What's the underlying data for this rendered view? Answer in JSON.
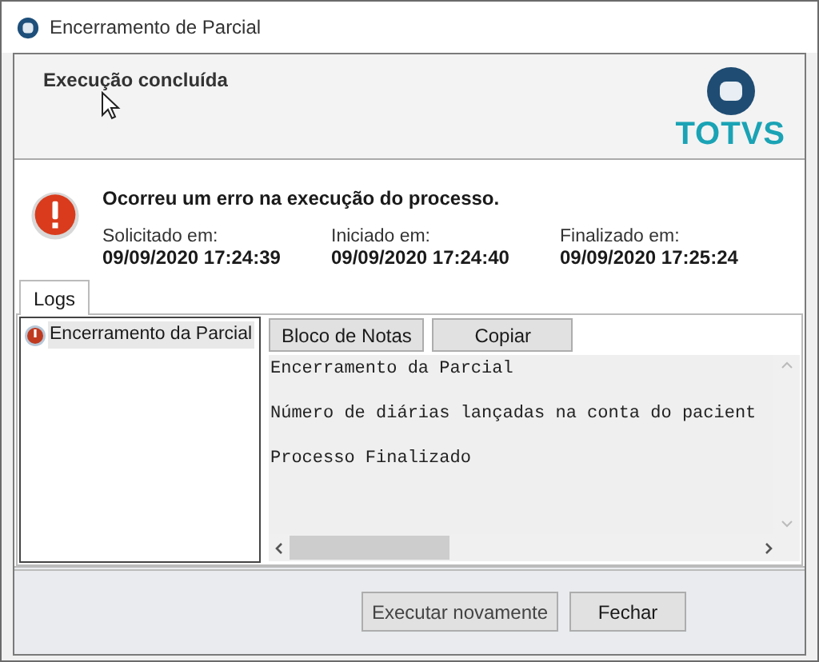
{
  "window": {
    "title": "Encerramento de Parcial"
  },
  "header": {
    "title": "Execução concluída",
    "logo": "TOTVS"
  },
  "message": "Ocorreu um erro na execução do processo.",
  "times": [
    {
      "label": "Solicitado em:",
      "value": "09/09/2020 17:24:39"
    },
    {
      "label": "Iniciado em:",
      "value": "09/09/2020 17:24:40"
    },
    {
      "label": "Finalizado em:",
      "value": "09/09/2020 17:25:24"
    }
  ],
  "tabs": [
    {
      "label": "Logs",
      "selected": true
    }
  ],
  "tree": [
    {
      "label": "Encerramento da Parcial",
      "selected": true
    }
  ],
  "log_buttons": [
    "Bloco de Notas",
    "Copiar"
  ],
  "log_lines": [
    "Encerramento da Parcial",
    "Número de diárias lançadas na conta do pacient",
    "Processo Finalizado"
  ],
  "buttons": [
    "Executar novamente",
    "Fechar"
  ]
}
